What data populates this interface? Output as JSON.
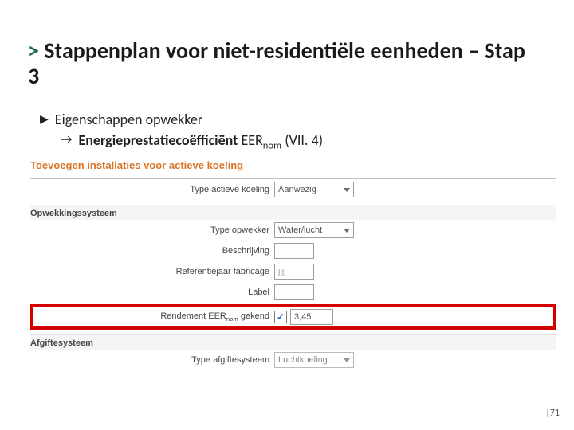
{
  "title_prefix": ">",
  "title": "Stappenplan voor niet-residentiële eenheden – Stap 3",
  "bullet1": "Eigenschappen opwekker",
  "bullet2_strong": "Energieprestatiecoëfficiënt",
  "bullet2_rest": " EER",
  "bullet2_sub": "nom",
  "bullet2_tail": " (VII. 4)",
  "form_heading": "Toevoegen installaties voor actieve koeling",
  "fields": {
    "type_active_label": "Type actieve koeling",
    "type_active_value": "Aanwezig",
    "opwekking_section": "Opwekkingssysteem",
    "type_opwekker_label": "Type opwekker",
    "type_opwekker_value": "Water/lucht",
    "beschrijving_label": "Beschrijving",
    "refjaar_label": "Referentiejaar fabricage",
    "refjaar_placeholder": "jjjj",
    "label_label": "Label",
    "rendement_label_pre": "Rendement EER",
    "rendement_label_sub": "nom",
    "rendement_label_post": " gekend",
    "rendement_value": "3,45",
    "afgifte_section": "Afgiftesysteem",
    "type_afgifte_label": "Type afgiftesysteem",
    "type_afgifte_value": "Luchtkoeling"
  },
  "page_number": "|71"
}
